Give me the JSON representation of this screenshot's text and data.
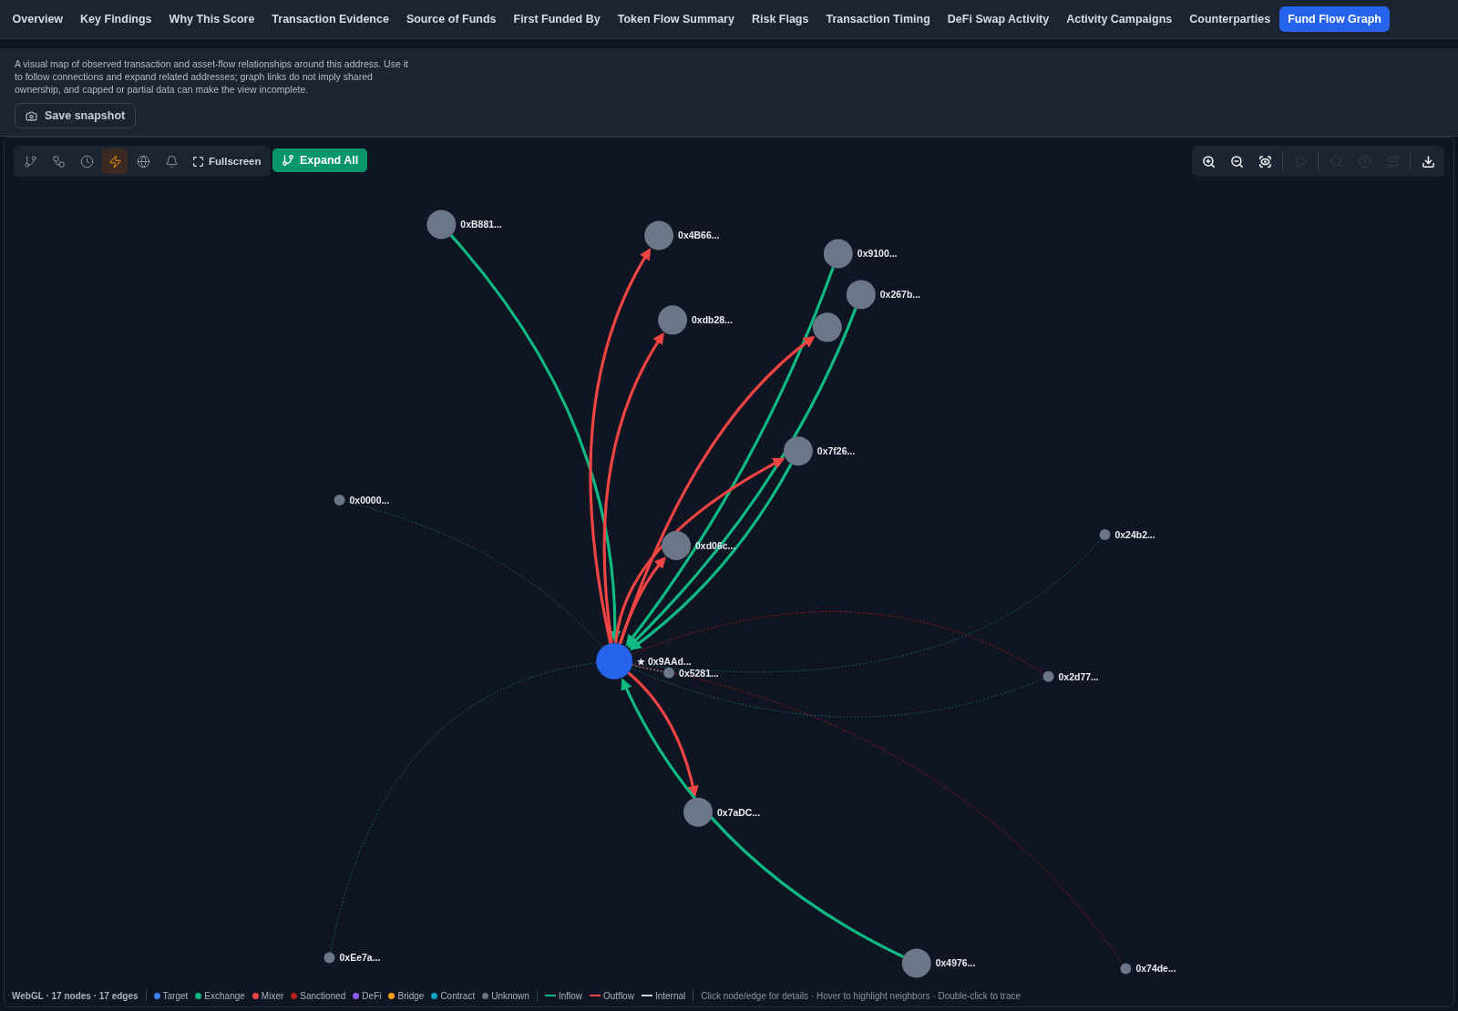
{
  "tabs": [
    {
      "label": "Overview",
      "selected": false
    },
    {
      "label": "Key Findings",
      "selected": false
    },
    {
      "label": "Why This Score",
      "selected": false
    },
    {
      "label": "Transaction Evidence",
      "selected": false
    },
    {
      "label": "Source of Funds",
      "selected": false
    },
    {
      "label": "First Funded By",
      "selected": false
    },
    {
      "label": "Token Flow Summary",
      "selected": false
    },
    {
      "label": "Risk Flags",
      "selected": false
    },
    {
      "label": "Transaction Timing",
      "selected": false
    },
    {
      "label": "DeFi Swap Activity",
      "selected": false
    },
    {
      "label": "Activity Campaigns",
      "selected": false
    },
    {
      "label": "Counterparties",
      "selected": false
    },
    {
      "label": "Fund Flow Graph",
      "selected": true
    }
  ],
  "description": "A visual map of observed transaction and asset-flow relationships around this address. Use it to follow connections and expand related addresses; graph links do not imply shared ownership, and capped or partial data can make the view incomplete.",
  "snapshot_button": "Save snapshot",
  "left_toolbar": {
    "tools": [
      {
        "active": false
      },
      {
        "active": false
      },
      {
        "active": false
      },
      {
        "active": true
      },
      {
        "active": false
      },
      {
        "active": false
      }
    ],
    "fullscreen": "Fullscreen",
    "expand_all": "Expand All"
  },
  "right_toolbar": {
    "tools": [
      {
        "disabled": false
      },
      {
        "disabled": false
      },
      {
        "disabled": false
      },
      {
        "disabled": true
      },
      {
        "disabled": true
      },
      {
        "disabled": true
      },
      {
        "disabled": true
      },
      {
        "disabled": false
      }
    ]
  },
  "nodes": [
    {
      "label": "★ 0x9AAd...",
      "kind": "target"
    },
    {
      "label": "0xB881...",
      "kind": "unknown",
      "links": [
        {
          "kind": "inflow"
        }
      ]
    },
    {
      "label": "0x4B66...",
      "kind": "unknown",
      "links": [
        {
          "kind": "outflow"
        }
      ]
    },
    {
      "label": "0x9100...",
      "kind": "unknown",
      "links": [
        {
          "kind": "inflow"
        }
      ]
    },
    {
      "label": "0x267b...",
      "kind": "unknown",
      "links": [
        {
          "kind": "inflow"
        }
      ]
    },
    {
      "label": "0xdb28...",
      "kind": "unknown",
      "links": [
        {
          "kind": "outflow"
        }
      ]
    },
    {
      "kind": "unknown",
      "links": [
        {
          "kind": "outflow"
        }
      ]
    },
    {
      "label": "0x7f26...",
      "kind": "unknown",
      "links": [
        {
          "kind": "outflow"
        },
        {
          "kind": "inflow"
        }
      ]
    },
    {
      "label": "0xd06c...",
      "kind": "unknown",
      "links": [
        {
          "kind": "outflow"
        }
      ]
    },
    {
      "label": "0x0000...",
      "kind": "unknown",
      "links": [
        {
          "kind": "inflow_weak"
        }
      ]
    },
    {
      "label": "0x24b2...",
      "kind": "unknown",
      "links": [
        {
          "kind": "inflow_weak"
        }
      ]
    },
    {
      "label": "0x2d77...",
      "kind": "unknown",
      "links": [
        {
          "kind": "outflow_weak"
        },
        {
          "kind": "inflow_weak"
        }
      ]
    },
    {
      "label": "0x5281...",
      "kind": "unknown",
      "links": [
        {
          "kind": "internal"
        }
      ]
    },
    {
      "label": "0x7aDC...",
      "kind": "unknown",
      "links": [
        {
          "kind": "outflow"
        }
      ]
    },
    {
      "label": "0xEe7a...",
      "kind": "unknown",
      "links": [
        {
          "kind": "inflow_weak"
        }
      ]
    },
    {
      "label": "0x4976...",
      "kind": "unknown",
      "links": [
        {
          "kind": "inflow"
        }
      ]
    },
    {
      "label": "0x74de...",
      "kind": "unknown",
      "links": [
        {
          "kind": "outflow_weak"
        }
      ]
    }
  ],
  "legend": {
    "stats": "WebGL · 17 nodes · 17 edges",
    "node_types": [
      {
        "label": "Target",
        "color": "#3b82f6"
      },
      {
        "label": "Exchange",
        "color": "#10b981"
      },
      {
        "label": "Mixer",
        "color": "#ef4444"
      },
      {
        "label": "Sanctioned",
        "color": "#b91c1c"
      },
      {
        "label": "DeFi",
        "color": "#8b5cf6"
      },
      {
        "label": "Bridge",
        "color": "#f59e0b"
      },
      {
        "label": "Contract",
        "color": "#0ea5c6"
      },
      {
        "label": "Unknown",
        "color": "#6b7280"
      }
    ],
    "flow_types": [
      {
        "label": "Inflow",
        "color": "#10b981"
      },
      {
        "label": "Outflow",
        "color": "#ef4444"
      },
      {
        "label": "Internal",
        "color": "#cbd5e1"
      }
    ],
    "hint": "Click node/edge for details · Hover to highlight neighbors · Double-click to trace"
  }
}
